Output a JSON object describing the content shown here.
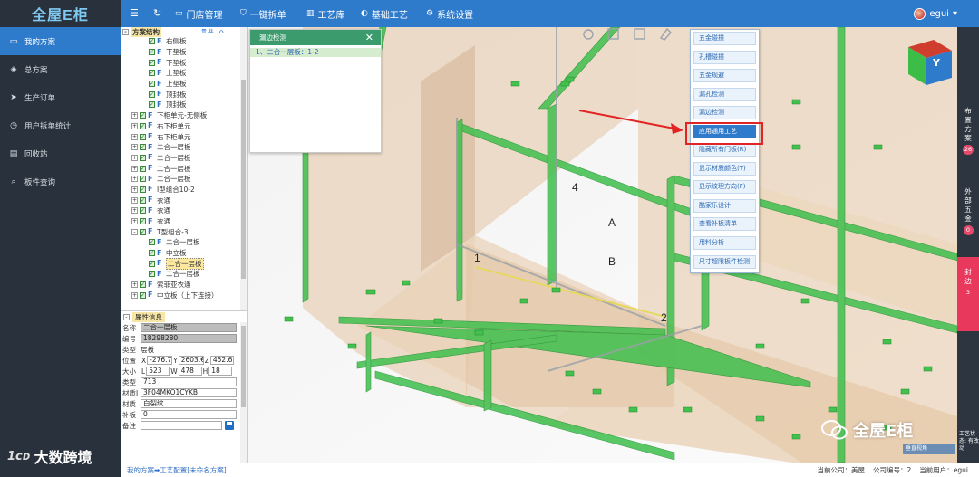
{
  "app": {
    "logo": "全屋E柜"
  },
  "nav": {
    "items": [
      {
        "label": "门店管理",
        "icon": "store-icon"
      },
      {
        "label": "一键拆单",
        "icon": "shield-check-icon"
      },
      {
        "label": "工艺库",
        "icon": "library-icon"
      },
      {
        "label": "基础工艺",
        "icon": "palette-icon"
      },
      {
        "label": "系统设置",
        "icon": "gear-icon"
      }
    ],
    "user": "egui"
  },
  "sidebar": {
    "items": [
      {
        "label": "我的方案",
        "icon": "monitor-icon",
        "active": true
      },
      {
        "label": "总方案",
        "icon": "diamond-icon"
      },
      {
        "label": "生产订单",
        "icon": "send-icon"
      },
      {
        "label": "用户拆单统计",
        "icon": "clock-icon"
      },
      {
        "label": "回收站",
        "icon": "trash-icon"
      },
      {
        "label": "板件查询",
        "icon": "search-icon"
      }
    ]
  },
  "tree": {
    "title": "方案结构",
    "rows": [
      {
        "indent": 2,
        "exp": "",
        "label": "右侧板"
      },
      {
        "indent": 2,
        "exp": "",
        "label": "下垫板"
      },
      {
        "indent": 2,
        "exp": "",
        "label": "下垫板"
      },
      {
        "indent": 2,
        "exp": "",
        "label": "上垫板"
      },
      {
        "indent": 2,
        "exp": "",
        "label": "上垫板"
      },
      {
        "indent": 2,
        "exp": "",
        "label": "顶封板"
      },
      {
        "indent": 2,
        "exp": "",
        "label": "顶封板"
      },
      {
        "indent": 1,
        "exp": "+",
        "label": "下柜单元-无侧板"
      },
      {
        "indent": 1,
        "exp": "+",
        "label": "右下柜单元"
      },
      {
        "indent": 1,
        "exp": "+",
        "label": "右下柜单元"
      },
      {
        "indent": 1,
        "exp": "+",
        "label": "二合一层板"
      },
      {
        "indent": 1,
        "exp": "+",
        "label": "二合一层板"
      },
      {
        "indent": 1,
        "exp": "+",
        "label": "二合一层板"
      },
      {
        "indent": 1,
        "exp": "+",
        "label": "二合一层板"
      },
      {
        "indent": 1,
        "exp": "+",
        "label": "I型组合10-2"
      },
      {
        "indent": 1,
        "exp": "+",
        "label": "衣通"
      },
      {
        "indent": 1,
        "exp": "+",
        "label": "衣通"
      },
      {
        "indent": 1,
        "exp": "+",
        "label": "衣通"
      },
      {
        "indent": 1,
        "exp": "-",
        "label": "T型组合-3"
      },
      {
        "indent": 2,
        "exp": "",
        "label": "二合一层板"
      },
      {
        "indent": 2,
        "exp": "",
        "label": "中立板"
      },
      {
        "indent": 2,
        "exp": "",
        "label": "二合一层板",
        "selected": true
      },
      {
        "indent": 2,
        "exp": "",
        "label": "二合一层板"
      },
      {
        "indent": 1,
        "exp": "+",
        "label": "索菲亚衣通"
      },
      {
        "indent": 1,
        "exp": "+",
        "label": "中立板（上下连接）"
      }
    ]
  },
  "props": {
    "title": "属性信息",
    "name_label": "名称",
    "name": "二合一层板",
    "code_label": "编号",
    "code": "18298280",
    "type_label": "类型",
    "type": "层板",
    "pos_label": "位置",
    "pos_x": "-276.7",
    "pos_y": "2603.€",
    "pos_z": "452.6",
    "size_label": "大小",
    "size_l": "523",
    "size_w": "478",
    "size_h": "18",
    "type2_label": "类型",
    "type2": "713",
    "material_code_label": "材质I",
    "material_code": "3F04MKO1CYKB",
    "material_label": "材质",
    "material": "白裂纹",
    "edge_label": "补板",
    "edge": "0",
    "note_label": "备注",
    "note": ""
  },
  "dialog": {
    "title": "漏边检测",
    "item": "1、二合一层板：1-2"
  },
  "context_menu": {
    "items": [
      "五金碰撞",
      "孔槽碰撞",
      "五金规避",
      "漏孔检测",
      "漏边检测",
      "应用通用工艺",
      "隐藏所有门板(R)",
      "显示材质颜色(T)",
      "显示纹理方向(F)",
      "酷家乐设计",
      "查看补板清单",
      "用料分析",
      "尺寸超限板件检测"
    ],
    "highlighted_index": 5
  },
  "right_tabs": [
    {
      "label": "布置方案",
      "badge": "26"
    },
    {
      "label": "外部五金",
      "badge": "0"
    },
    {
      "label": "封边",
      "badge": "3"
    }
  ],
  "viewport": {
    "labels": {
      "A": "A",
      "B": "B",
      "n1": "1",
      "n2": "2",
      "n4": "4"
    },
    "cube_label": "Y",
    "bottom_combo": "垂直视角",
    "edge_text": "工艺状态: 有改动"
  },
  "statusbar": {
    "crumb": "我的方案➡工艺配置[未命名方案]",
    "company_label": "当前公司：美屋",
    "company_code_label": "公司编号：2",
    "user_label": "当前用户：egui"
  },
  "watermarks": {
    "wechat": "全屋E柜",
    "bottom_left": "大数跨境",
    "bottom_left_mark": "1ᴄᴅ"
  },
  "colors": {
    "nav": "#2f7bcb",
    "sidebar": "#29323c",
    "accent_red": "#e22424",
    "panel_green": "#2fb34a"
  }
}
